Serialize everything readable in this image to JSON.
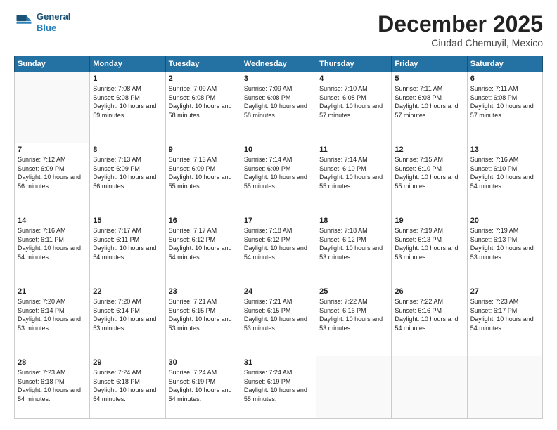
{
  "logo": {
    "line1": "General",
    "line2": "Blue"
  },
  "header": {
    "month": "December 2025",
    "location": "Ciudad Chemuyil, Mexico"
  },
  "weekdays": [
    "Sunday",
    "Monday",
    "Tuesday",
    "Wednesday",
    "Thursday",
    "Friday",
    "Saturday"
  ],
  "weeks": [
    [
      {
        "day": null
      },
      {
        "day": 1,
        "sunrise": "7:08 AM",
        "sunset": "6:08 PM",
        "daylight": "10 hours and 59 minutes."
      },
      {
        "day": 2,
        "sunrise": "7:09 AM",
        "sunset": "6:08 PM",
        "daylight": "10 hours and 58 minutes."
      },
      {
        "day": 3,
        "sunrise": "7:09 AM",
        "sunset": "6:08 PM",
        "daylight": "10 hours and 58 minutes."
      },
      {
        "day": 4,
        "sunrise": "7:10 AM",
        "sunset": "6:08 PM",
        "daylight": "10 hours and 57 minutes."
      },
      {
        "day": 5,
        "sunrise": "7:11 AM",
        "sunset": "6:08 PM",
        "daylight": "10 hours and 57 minutes."
      },
      {
        "day": 6,
        "sunrise": "7:11 AM",
        "sunset": "6:08 PM",
        "daylight": "10 hours and 57 minutes."
      }
    ],
    [
      {
        "day": 7,
        "sunrise": "7:12 AM",
        "sunset": "6:09 PM",
        "daylight": "10 hours and 56 minutes."
      },
      {
        "day": 8,
        "sunrise": "7:13 AM",
        "sunset": "6:09 PM",
        "daylight": "10 hours and 56 minutes."
      },
      {
        "day": 9,
        "sunrise": "7:13 AM",
        "sunset": "6:09 PM",
        "daylight": "10 hours and 55 minutes."
      },
      {
        "day": 10,
        "sunrise": "7:14 AM",
        "sunset": "6:09 PM",
        "daylight": "10 hours and 55 minutes."
      },
      {
        "day": 11,
        "sunrise": "7:14 AM",
        "sunset": "6:10 PM",
        "daylight": "10 hours and 55 minutes."
      },
      {
        "day": 12,
        "sunrise": "7:15 AM",
        "sunset": "6:10 PM",
        "daylight": "10 hours and 55 minutes."
      },
      {
        "day": 13,
        "sunrise": "7:16 AM",
        "sunset": "6:10 PM",
        "daylight": "10 hours and 54 minutes."
      }
    ],
    [
      {
        "day": 14,
        "sunrise": "7:16 AM",
        "sunset": "6:11 PM",
        "daylight": "10 hours and 54 minutes."
      },
      {
        "day": 15,
        "sunrise": "7:17 AM",
        "sunset": "6:11 PM",
        "daylight": "10 hours and 54 minutes."
      },
      {
        "day": 16,
        "sunrise": "7:17 AM",
        "sunset": "6:12 PM",
        "daylight": "10 hours and 54 minutes."
      },
      {
        "day": 17,
        "sunrise": "7:18 AM",
        "sunset": "6:12 PM",
        "daylight": "10 hours and 54 minutes."
      },
      {
        "day": 18,
        "sunrise": "7:18 AM",
        "sunset": "6:12 PM",
        "daylight": "10 hours and 53 minutes."
      },
      {
        "day": 19,
        "sunrise": "7:19 AM",
        "sunset": "6:13 PM",
        "daylight": "10 hours and 53 minutes."
      },
      {
        "day": 20,
        "sunrise": "7:19 AM",
        "sunset": "6:13 PM",
        "daylight": "10 hours and 53 minutes."
      }
    ],
    [
      {
        "day": 21,
        "sunrise": "7:20 AM",
        "sunset": "6:14 PM",
        "daylight": "10 hours and 53 minutes."
      },
      {
        "day": 22,
        "sunrise": "7:20 AM",
        "sunset": "6:14 PM",
        "daylight": "10 hours and 53 minutes."
      },
      {
        "day": 23,
        "sunrise": "7:21 AM",
        "sunset": "6:15 PM",
        "daylight": "10 hours and 53 minutes."
      },
      {
        "day": 24,
        "sunrise": "7:21 AM",
        "sunset": "6:15 PM",
        "daylight": "10 hours and 53 minutes."
      },
      {
        "day": 25,
        "sunrise": "7:22 AM",
        "sunset": "6:16 PM",
        "daylight": "10 hours and 53 minutes."
      },
      {
        "day": 26,
        "sunrise": "7:22 AM",
        "sunset": "6:16 PM",
        "daylight": "10 hours and 54 minutes."
      },
      {
        "day": 27,
        "sunrise": "7:23 AM",
        "sunset": "6:17 PM",
        "daylight": "10 hours and 54 minutes."
      }
    ],
    [
      {
        "day": 28,
        "sunrise": "7:23 AM",
        "sunset": "6:18 PM",
        "daylight": "10 hours and 54 minutes."
      },
      {
        "day": 29,
        "sunrise": "7:24 AM",
        "sunset": "6:18 PM",
        "daylight": "10 hours and 54 minutes."
      },
      {
        "day": 30,
        "sunrise": "7:24 AM",
        "sunset": "6:19 PM",
        "daylight": "10 hours and 54 minutes."
      },
      {
        "day": 31,
        "sunrise": "7:24 AM",
        "sunset": "6:19 PM",
        "daylight": "10 hours and 55 minutes."
      },
      {
        "day": null
      },
      {
        "day": null
      },
      {
        "day": null
      }
    ]
  ]
}
